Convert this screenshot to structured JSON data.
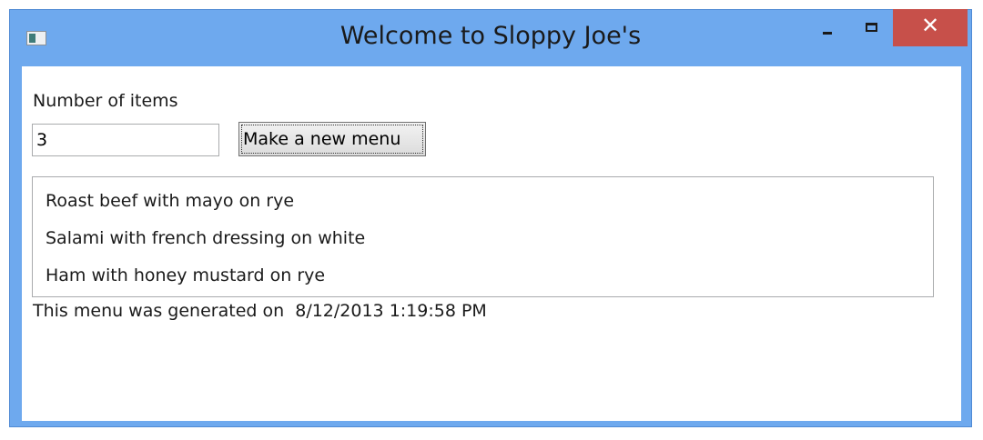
{
  "window": {
    "title": "Welcome to Sloppy Joe's",
    "colors": {
      "frame": "#6ea9ee",
      "close_button": "#c7504a"
    },
    "icons": {
      "app": "app-window-icon",
      "minimize": "minimize-icon",
      "maximize": "maximize-icon",
      "close": "close-icon"
    }
  },
  "form": {
    "items_label": "Number of items",
    "items_value": "3",
    "make_button_label": "Make a new menu"
  },
  "menu": {
    "items": [
      "Roast beef with mayo on rye",
      "Salami with french dressing on white",
      "Ham with honey mustard on rye"
    ]
  },
  "footer": {
    "generated_text": "This menu was generated on  8/12/2013 1:19:58 PM"
  }
}
